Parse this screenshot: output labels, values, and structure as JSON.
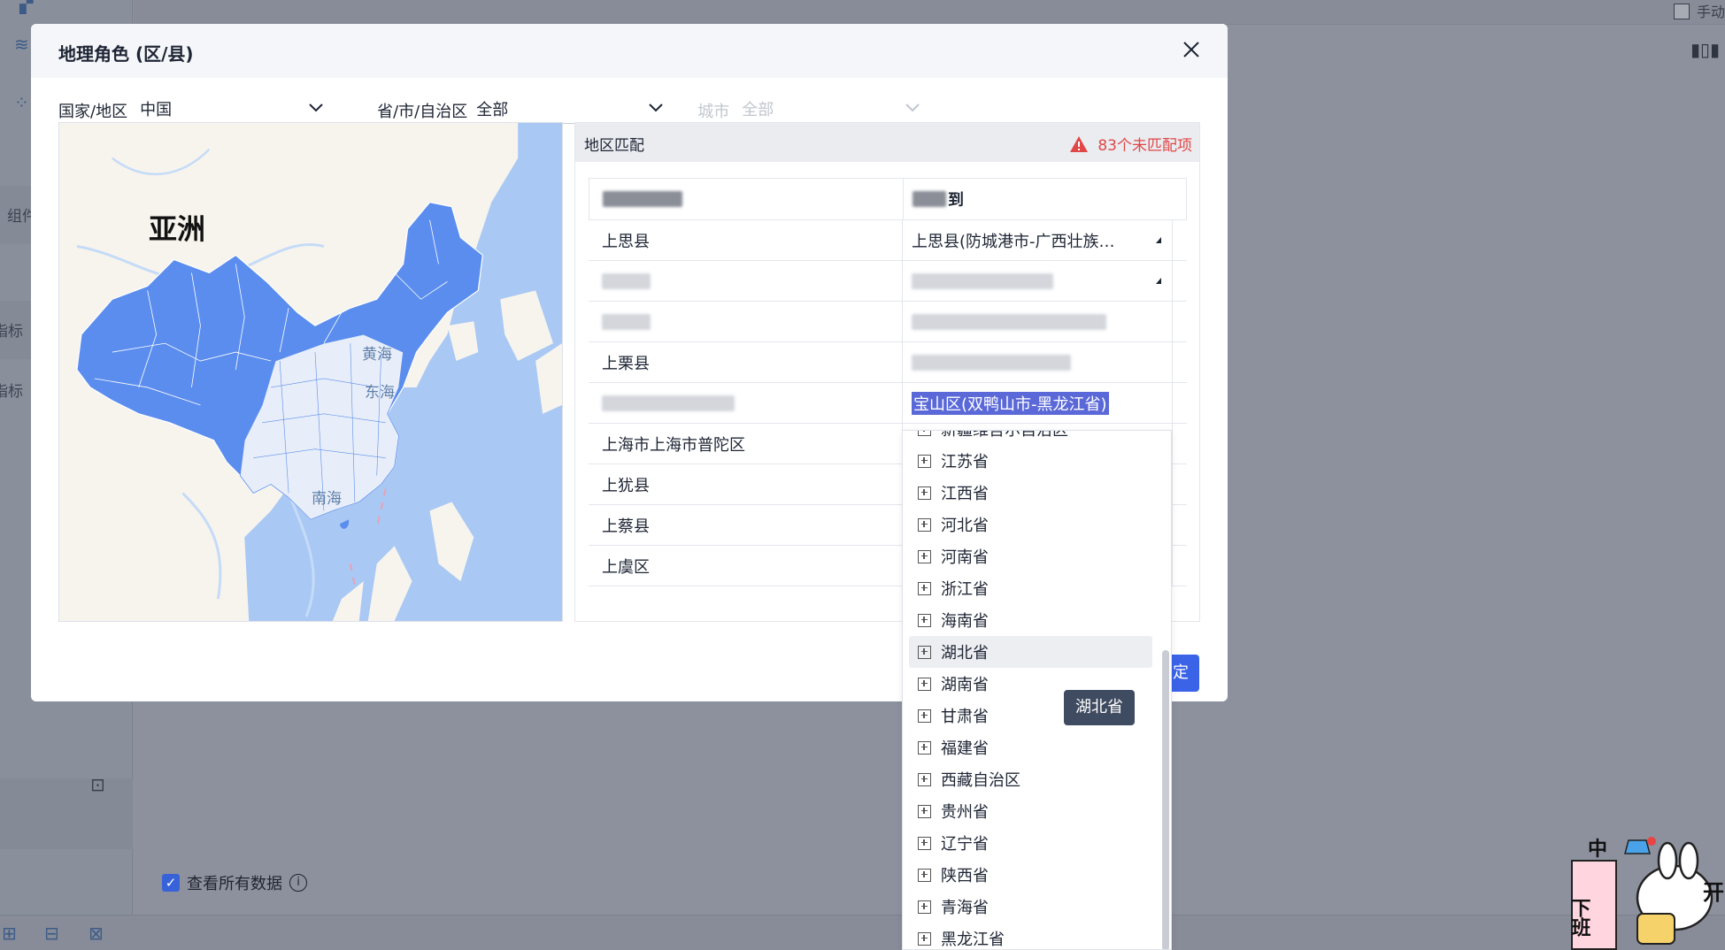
{
  "background": {
    "manual_label": "手动",
    "left_labels": [
      "组件",
      "指标",
      "指标"
    ],
    "view_all_label": "查看所有数据",
    "view_all_checked": true
  },
  "modal": {
    "title": "地理角色 (区/县)",
    "filters": {
      "country": {
        "label": "国家/地区",
        "value": "中国"
      },
      "province": {
        "label": "省/市/自治区",
        "value": "全部"
      },
      "city": {
        "label": "城市",
        "value": "全部",
        "disabled": true
      }
    },
    "map": {
      "continent_label": "亚洲",
      "seas": [
        "黄海",
        "东海",
        "南海"
      ],
      "highlight_color": "#5b8dee",
      "water_color": "#a9c8f4",
      "land_color": "#f7f4ee"
    },
    "match": {
      "title": "地区匹配",
      "unmatched_text": "83个未匹配项",
      "header": {
        "col2_suffix": "到"
      },
      "rows": [
        {
          "source": "上思县",
          "target": "上思县(防城港市-广西壮族…"
        },
        {
          "source": "",
          "target": ""
        },
        {
          "source": "",
          "target": ""
        },
        {
          "source": "上栗县",
          "target": ""
        },
        {
          "source": "",
          "target": "宝山区(双鸭山市-黑龙江省)"
        },
        {
          "source": "上海市上海市普陀区",
          "target": ""
        },
        {
          "source": "上犹县",
          "target": ""
        },
        {
          "source": "上蔡县",
          "target": ""
        },
        {
          "source": "上虞区",
          "target": ""
        }
      ]
    },
    "ok_label": "定"
  },
  "dropdown": {
    "items": [
      "新疆维吾尔自治区",
      "江苏省",
      "江西省",
      "河北省",
      "河南省",
      "浙江省",
      "海南省",
      "湖北省",
      "湖南省",
      "甘肃省",
      "福建省",
      "西藏自治区",
      "贵州省",
      "辽宁省",
      "陕西省",
      "青海省",
      "黑龙江省"
    ],
    "hovered": "湖北省"
  },
  "tooltip": {
    "text": "湖北省"
  },
  "sticker": {
    "top_char": "中",
    "left_chars": "下班",
    "right_char": "开"
  }
}
